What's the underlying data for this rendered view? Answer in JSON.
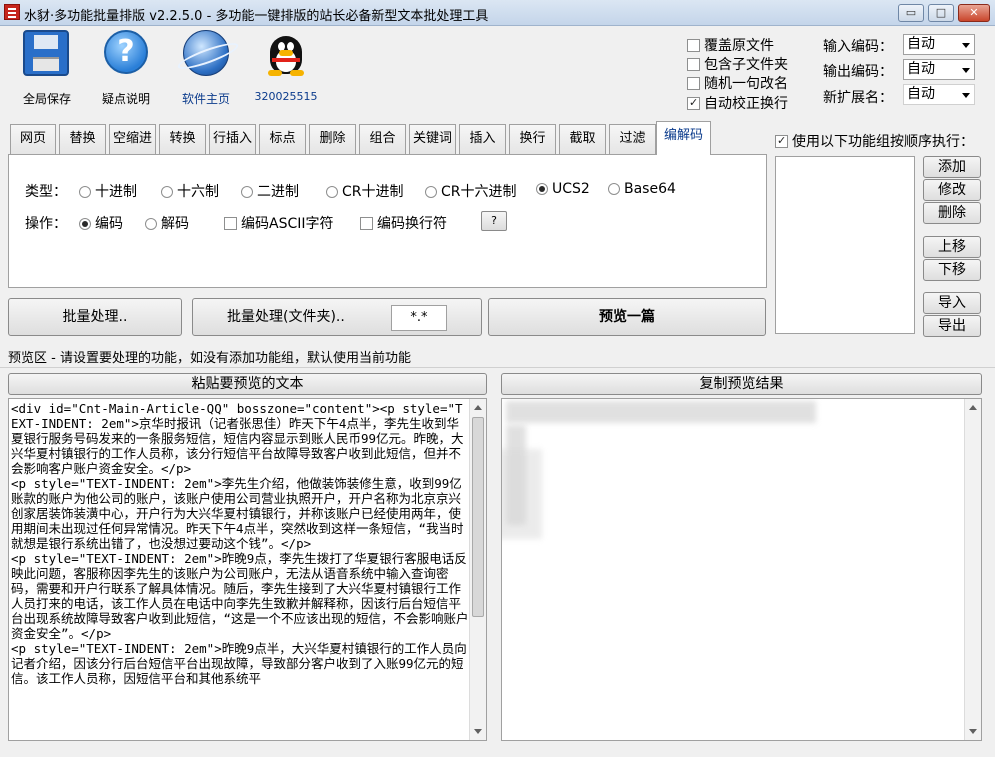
{
  "window": {
    "title": "水豺·多功能批量排版 v2.2.5.0 - 多功能一键排版的站长必备新型文本批处理工具",
    "minimize": "▭",
    "maximize": "□",
    "close": "✕"
  },
  "toolbar": {
    "save_label": "全局保存",
    "help_label": "疑点说明",
    "home_label": "软件主页",
    "qq_label": "320025515",
    "help_glyph": "?"
  },
  "options": {
    "overwrite": "覆盖原文件",
    "subfolders": "包含子文件夹",
    "random_rename": "随机一句改名",
    "auto_wrap": "自动校正换行"
  },
  "encoding": {
    "input_label": "输入编码：",
    "input_value": "自动",
    "output_label": "输出编码：",
    "output_value": "自动",
    "ext_label": "新扩展名：",
    "ext_value": "自动"
  },
  "tabs": [
    "网页",
    "替换",
    "空缩进",
    "转换",
    "行插入",
    "标点",
    "删除",
    "组合",
    "关键词",
    "插入",
    "换行",
    "截取",
    "过滤",
    "编解码"
  ],
  "codec": {
    "type_label": "类型：",
    "types": [
      "十进制",
      "十六制",
      "二进制",
      "CR十进制",
      "CR十六进制",
      "UCS2",
      "Base64"
    ],
    "op_label": "操作：",
    "encode": "编码",
    "decode": "解码",
    "encode_ascii": "编码ASCII字符",
    "encode_newline": "编码换行符",
    "help_btn": "?"
  },
  "actions": {
    "batch": "批量处理..",
    "batch_folder": "批量处理(文件夹)..",
    "filter_value": "*.*",
    "preview_one": "预览一篇"
  },
  "sequence": {
    "check_label": "使用以下功能组按顺序执行：",
    "add": "添加",
    "modify": "修改",
    "delete": "删除",
    "up": "上移",
    "down": "下移",
    "import": "导入",
    "export": "导出"
  },
  "preview": {
    "hint": "预览区 - 请设置要处理的功能，如没有添加功能组，默认使用当前功能",
    "paste_btn": "粘贴要预览的文本",
    "copy_btn": "复制预览结果",
    "source_text": "<div id=\"Cnt-Main-Article-QQ\" bosszone=\"content\"><p style=\"TEXT-INDENT: 2em\">京华时报讯（记者张思佳）昨天下午4点半，李先生收到华夏银行服务号码发来的一条服务短信，短信内容显示到账人民币99亿元。昨晚，大兴华夏村镇银行的工作人员称，该分行短信平台故障导致客户收到此短信，但并不会影响客户账户资金安全。</p>\n<p style=\"TEXT-INDENT: 2em\">李先生介绍，他做装饰装修生意，收到99亿账款的账户为他公司的账户，该账户使用公司营业执照开户，开户名称为北京京兴创家居装饰装潢中心，开户行为大兴华夏村镇银行，并称该账户已经使用两年，使用期间未出现过任何异常情况。昨天下午4点半，突然收到这样一条短信，“我当时就想是银行系统出错了，也没想过要动这个钱”。</p>\n<p style=\"TEXT-INDENT: 2em\">昨晚9点，李先生拨打了华夏银行客服电话反映此问题，客服称因李先生的该账户为公司账户，无法从语音系统中输入查询密码，需要和开户行联系了解具体情况。随后，李先生接到了大兴华夏村镇银行工作人员打来的电话，该工作人员在电话中向李先生致歉并解释称，因该行后台短信平台出现系统故障导致客户收到此短信，“这是一个不应该出现的短信，不会影响账户资金安全”。</p>\n<p style=\"TEXT-INDENT: 2em\">昨晚9点半，大兴华夏村镇银行的工作人员向记者介绍，因该分行后台短信平台出现故障，导致部分客户收到了入账99亿元的短信。该工作人员称，因短信平台和其他系统平"
  }
}
